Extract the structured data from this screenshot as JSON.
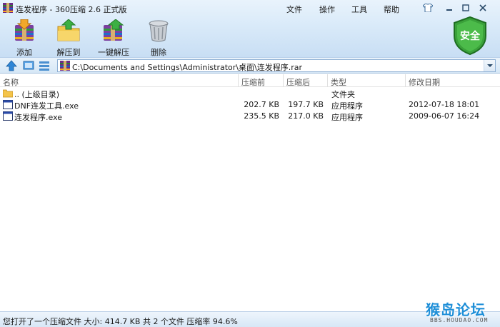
{
  "window": {
    "title": "连发程序 - 360压缩 2.6 正式版"
  },
  "menu": [
    {
      "label": "文件"
    },
    {
      "label": "操作"
    },
    {
      "label": "工具"
    },
    {
      "label": "帮助"
    }
  ],
  "toolbar": [
    {
      "label": "添加",
      "icon": "add-archive-icon"
    },
    {
      "label": "解压到",
      "icon": "extract-to-icon"
    },
    {
      "label": "一键解压",
      "icon": "one-click-extract-icon"
    },
    {
      "label": "删除",
      "icon": "trash-icon"
    }
  ],
  "safe_badge": {
    "label": "安全"
  },
  "address": {
    "path": "C:\\Documents and Settings\\Administrator\\桌面\\连发程序.rar"
  },
  "columns": [
    {
      "label": "名称"
    },
    {
      "label": "压缩前"
    },
    {
      "label": "压缩后"
    },
    {
      "label": "类型"
    },
    {
      "label": "修改日期"
    }
  ],
  "rows": [
    {
      "name": ".. (上级目录)",
      "before": "",
      "after": "",
      "type": "文件夹",
      "date": "",
      "icon": "folder-icon"
    },
    {
      "name": "DNF连发工具.exe",
      "before": "202.7 KB",
      "after": "197.7 KB",
      "type": "应用程序",
      "date": "2012-07-18 18:01",
      "icon": "exe-icon"
    },
    {
      "name": "连发程序.exe",
      "before": "235.5 KB",
      "after": "217.0 KB",
      "type": "应用程序",
      "date": "2009-06-07 16:24",
      "icon": "exe-icon"
    }
  ],
  "status": {
    "text": "您打开了一个压缩文件 大小: 414.7 KB 共 2 个文件 压缩率 94.6%"
  },
  "watermark": {
    "main": "猴岛论坛",
    "sub": "BBS.HOUDAO.COM"
  },
  "colors": {
    "accent": "#1f8fd8",
    "badge_green": "#3aa13a",
    "band_top": "#e9f3fc",
    "band_bottom": "#c8def4"
  }
}
